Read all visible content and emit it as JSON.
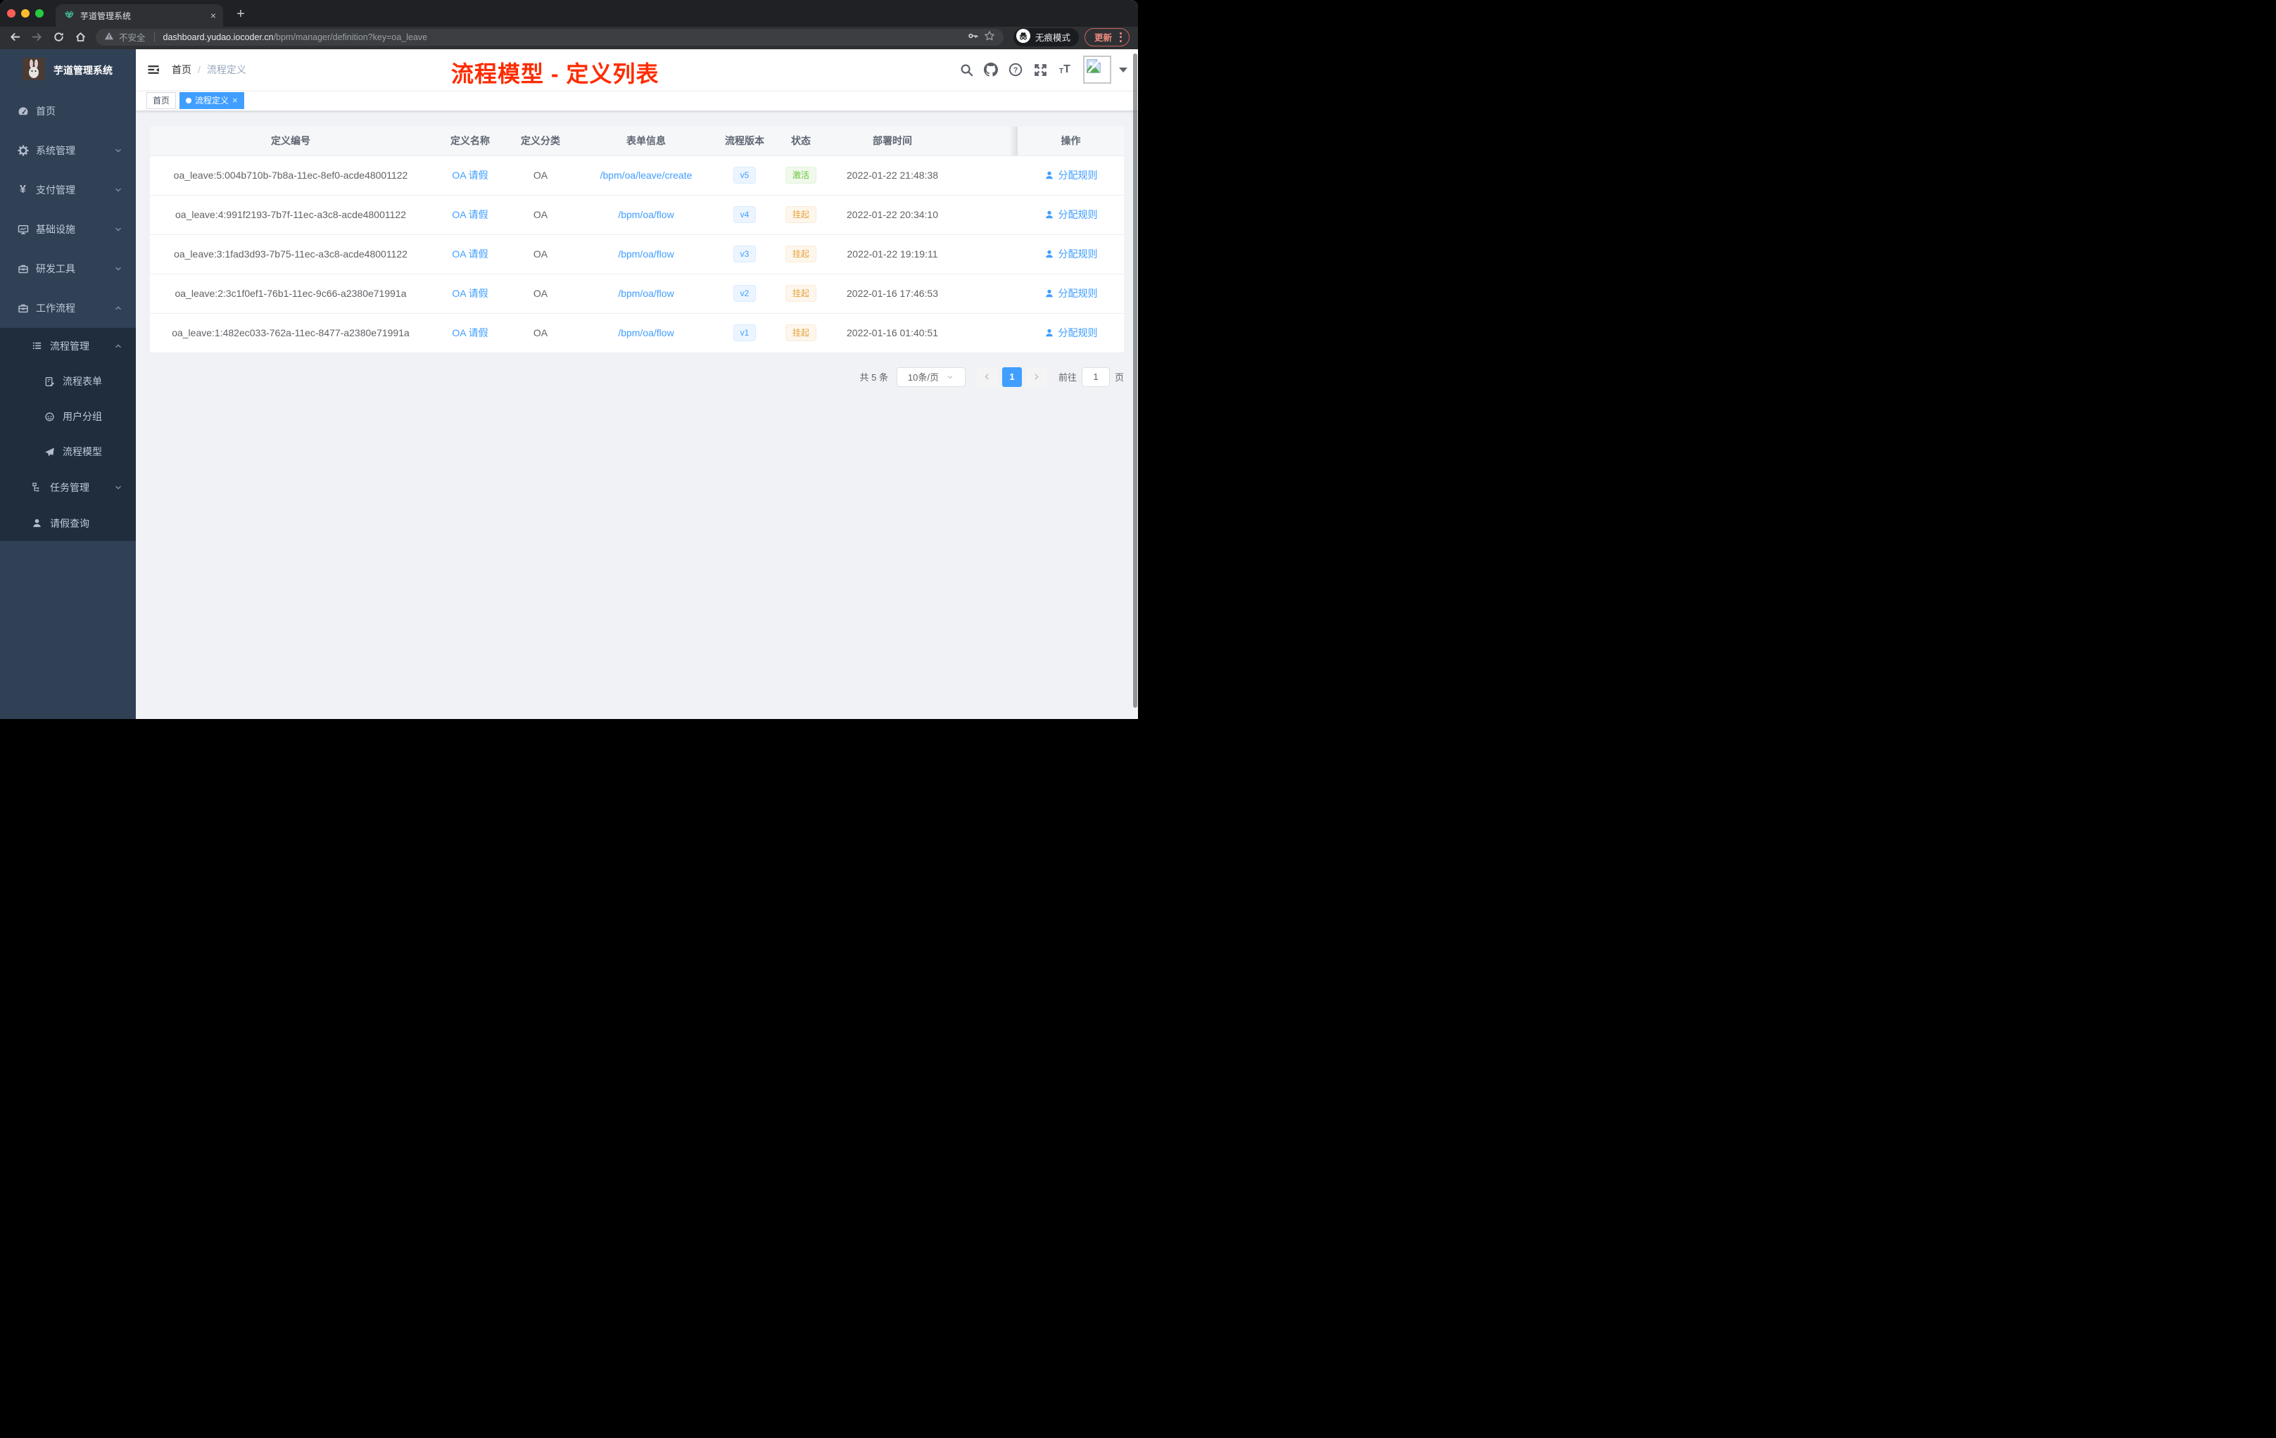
{
  "browser": {
    "tab": {
      "title": "芋道管理系统",
      "close_glyph": "×",
      "new_tab_glyph": "+"
    },
    "address": {
      "security_label": "不安全",
      "url_domain": "dashboard.yudao.iocoder.cn",
      "url_path": "/bpm/manager/definition?key=oa_leave"
    },
    "incognito_label": "无痕模式",
    "update_label": "更新"
  },
  "sidebar": {
    "title": "芋道管理系统",
    "items": [
      {
        "label": "首页"
      },
      {
        "label": "系统管理"
      },
      {
        "label": "支付管理"
      },
      {
        "label": "基础设施"
      },
      {
        "label": "研发工具"
      },
      {
        "label": "工作流程"
      },
      {
        "label": "流程管理"
      },
      {
        "label": "流程表单"
      },
      {
        "label": "用户分组"
      },
      {
        "label": "流程模型"
      },
      {
        "label": "任务管理"
      },
      {
        "label": "请假查询"
      }
    ]
  },
  "navbar": {
    "breadcrumb": {
      "home": "首页",
      "separator": "/",
      "current": "流程定义"
    },
    "annotation": "流程模型 - 定义列表"
  },
  "tags_view": {
    "tags": [
      {
        "label": "首页"
      },
      {
        "label": "流程定义"
      }
    ]
  },
  "table": {
    "columns": [
      "定义编号",
      "定义名称",
      "定义分类",
      "表单信息",
      "流程版本",
      "状态",
      "部署时间",
      "操作"
    ],
    "rows": [
      {
        "id": "oa_leave:5:004b710b-7b8a-11ec-8ef0-acde48001122",
        "name": "OA 请假",
        "category": "OA",
        "form": "/bpm/oa/leave/create",
        "version": "v5",
        "status": "激活",
        "time": "2022-01-22 21:48:38",
        "action": "分配规则"
      },
      {
        "id": "oa_leave:4:991f2193-7b7f-11ec-a3c8-acde48001122",
        "name": "OA 请假",
        "category": "OA",
        "form": "/bpm/oa/flow",
        "version": "v4",
        "status": "挂起",
        "time": "2022-01-22 20:34:10",
        "action": "分配规则"
      },
      {
        "id": "oa_leave:3:1fad3d93-7b75-11ec-a3c8-acde48001122",
        "name": "OA 请假",
        "category": "OA",
        "form": "/bpm/oa/flow",
        "version": "v3",
        "status": "挂起",
        "time": "2022-01-22 19:19:11",
        "action": "分配规则"
      },
      {
        "id": "oa_leave:2:3c1f0ef1-76b1-11ec-9c66-a2380e71991a",
        "name": "OA 请假",
        "category": "OA",
        "form": "/bpm/oa/flow",
        "version": "v2",
        "status": "挂起",
        "time": "2022-01-16 17:46:53",
        "action": "分配规则"
      },
      {
        "id": "oa_leave:1:482ec033-762a-11ec-8477-a2380e71991a",
        "name": "OA 请假",
        "category": "OA",
        "form": "/bpm/oa/flow",
        "version": "v1",
        "status": "挂起",
        "time": "2022-01-16 01:40:51",
        "action": "分配规则"
      }
    ]
  },
  "pagination": {
    "total": "共 5 条",
    "page_size": "10条/页",
    "current_page": "1",
    "goto_label": "前往",
    "goto_value": "1",
    "goto_suffix": "页"
  },
  "colors": {
    "accent_blue": "#409eff",
    "annotation_red": "#fe2c00",
    "status_active_green": "#67c23a",
    "status_suspended_orange": "#e6a23c",
    "sidebar_bg": "#304156",
    "submenu_bg": "#1f2d3d"
  }
}
